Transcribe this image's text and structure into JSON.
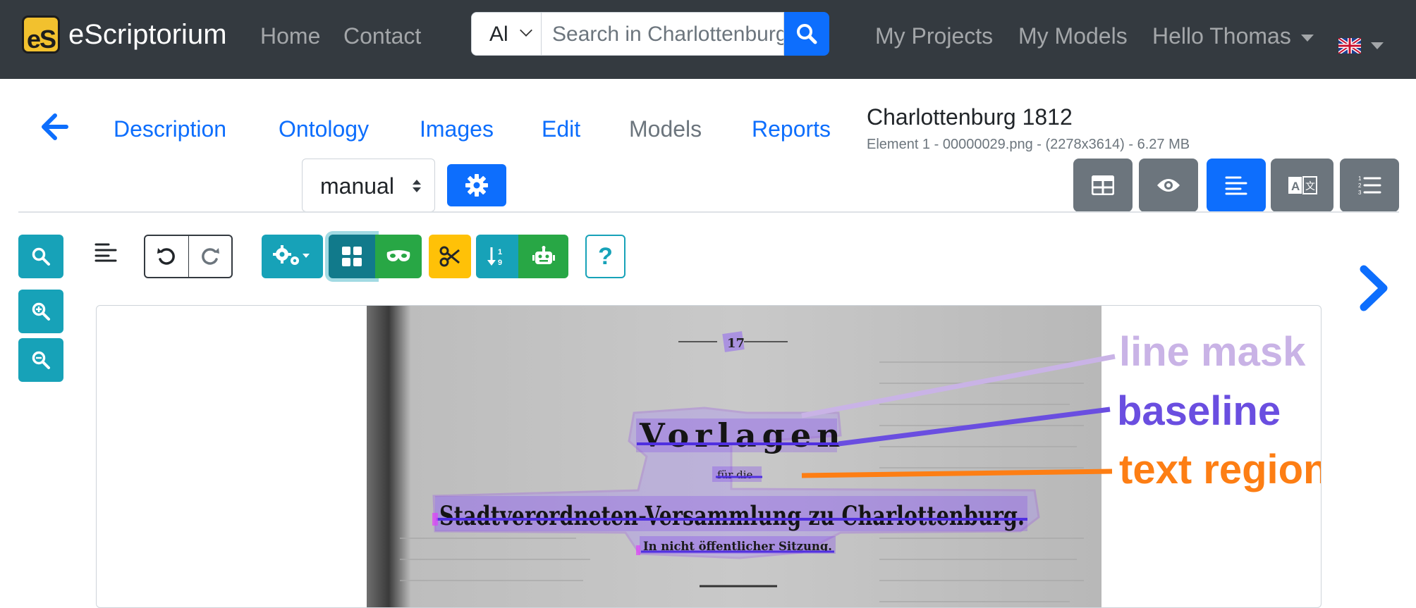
{
  "navbar": {
    "brand_logo_text": "eS",
    "brand_name": "eScriptorium",
    "links": [
      "Home",
      "Contact"
    ],
    "search_scope": "Al",
    "search_placeholder": "Search in Charlottenburg",
    "right_links": [
      "My Projects",
      "My Models"
    ],
    "user_greeting": "Hello Thomas",
    "language_flag": "uk-flag-icon"
  },
  "tabs": {
    "items": [
      "Description",
      "Ontology",
      "Images",
      "Edit",
      "Models",
      "Reports"
    ],
    "active": "Models"
  },
  "document": {
    "title": "Charlottenburg 1812",
    "subtitle": "Element 1 - 00000029.png - (2278x3614) - 6.27 MB"
  },
  "transcription_select": "manual",
  "view_buttons": [
    "table-icon",
    "eye-icon",
    "align-left-icon",
    "translate-icon",
    "list-ol-icon"
  ],
  "toolbar": {
    "tools": [
      "settings-icon",
      "regions-icon",
      "mask-icon",
      "cut-icon",
      "sort-icon",
      "robot-icon",
      "help-icon"
    ],
    "help_label": "?"
  },
  "page_image": {
    "heading": "Vorlagen",
    "small_text": "für die",
    "main_line": "Stadtverordneten-Versammlung zu Charlottenburg.",
    "sub_line": "In nicht öffentlicher Sitzung.",
    "page_number": "17"
  },
  "annotations": [
    {
      "label": "line mask",
      "color": "#c9b3e6"
    },
    {
      "label": "baseline",
      "color": "#6a4ee0"
    },
    {
      "label": "text region",
      "color": "#fd7e14"
    }
  ],
  "colors": {
    "navbar": "#343a40",
    "primary": "#0d6efd",
    "teal": "#17a2b8",
    "green": "#28a745",
    "yellow": "#ffc107",
    "secondary": "#6c757d"
  }
}
